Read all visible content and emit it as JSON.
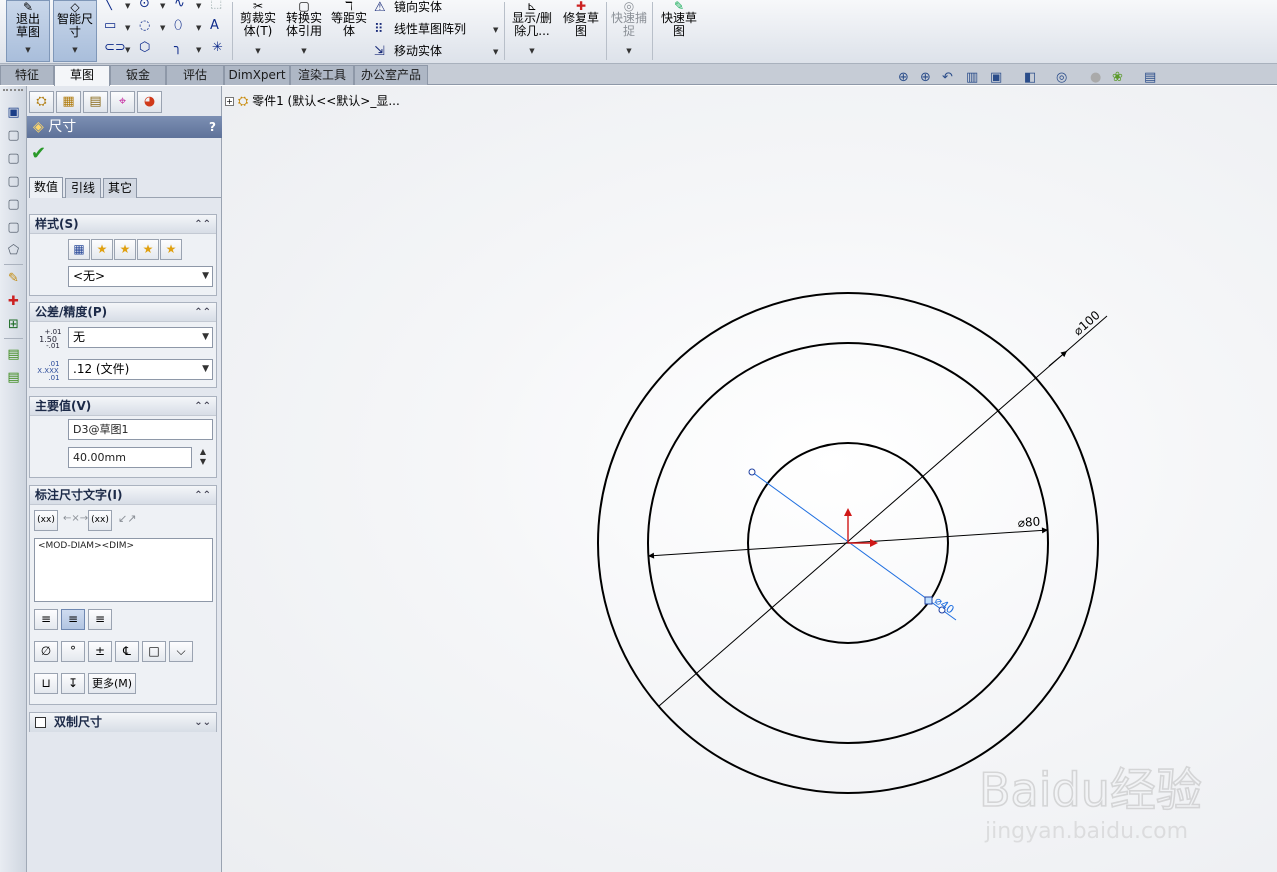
{
  "toolbar": {
    "exit_sketch": "退出草图",
    "smart_dimension": "智能尺寸",
    "trim": "剪裁实体(T)",
    "convert": "转换实体引用",
    "offset": "等距实体",
    "mirror": "镜向实体",
    "linear_pattern": "线性草图阵列",
    "move": "移动实体",
    "show_delete": "显示/删除几...",
    "repair": "修复草图",
    "quick_snaps": "快速捕捉",
    "rapid_sketch": "快速草图"
  },
  "tabs": [
    "特征",
    "草图",
    "钣金",
    "评估",
    "DimXpert",
    "渲染工具",
    "办公室产品"
  ],
  "active_tab": "草图",
  "feature_tree": {
    "root": "零件1  (默认<<默认>_显..."
  },
  "property_manager": {
    "title": "尺寸",
    "help": "?",
    "subtabs": [
      "数值",
      "引线",
      "其它"
    ],
    "style_group": {
      "title": "样式(S)",
      "selected": "<无>"
    },
    "tolerance_group": {
      "title": "公差/精度(P)",
      "tolerance_type": "无",
      "precision": ".12 (文件)",
      "tol_icon_label": "1.50",
      "tol_icon_plus": "+.01",
      "tol_icon_minus": "-.01",
      "prec_icon_label": "X.XXX",
      "prec_icon_plus": ".01",
      "prec_icon_minus": ".01"
    },
    "primary_value_group": {
      "title": "主要值(V)",
      "name": "D3@草图1",
      "value": "40.00mm"
    },
    "dim_text_group": {
      "title": "标注尺寸文字(I)",
      "btn_xx1": "(xx)",
      "btn_xx2": "(xx)",
      "text": "<MOD-DIAM><DIM>",
      "more": "更多(M)"
    },
    "dual_dim": {
      "title": "双制尺寸"
    }
  },
  "sketch": {
    "dim_outer": "⌀100",
    "dim_middle": "⌀80",
    "dim_inner": "⌀40",
    "accent": "#1f6fe0",
    "origin_color": "#d01818"
  },
  "watermark": {
    "brand": "Baidu经验",
    "url": "jingyan.baidu.com"
  }
}
